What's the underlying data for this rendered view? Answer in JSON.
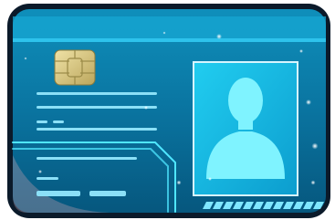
{
  "scene": {
    "subject": "id-card-illustration",
    "colors": {
      "card_frame": "#0b1a2a",
      "card_top": "#0f89b2",
      "card_bottom": "#055f86",
      "header_band": "#16a9d6",
      "accent": "#4fe6ff",
      "line": "#7cd8f5",
      "photo_bg": "#14bde6",
      "silhouette": "#7ff3ff",
      "chip": "#d8c98a",
      "chip_lines": "#9a8a47"
    },
    "icons": [
      "chip-icon",
      "person-silhouette-icon"
    ],
    "text_lines": 10,
    "stripe_count": 12
  }
}
